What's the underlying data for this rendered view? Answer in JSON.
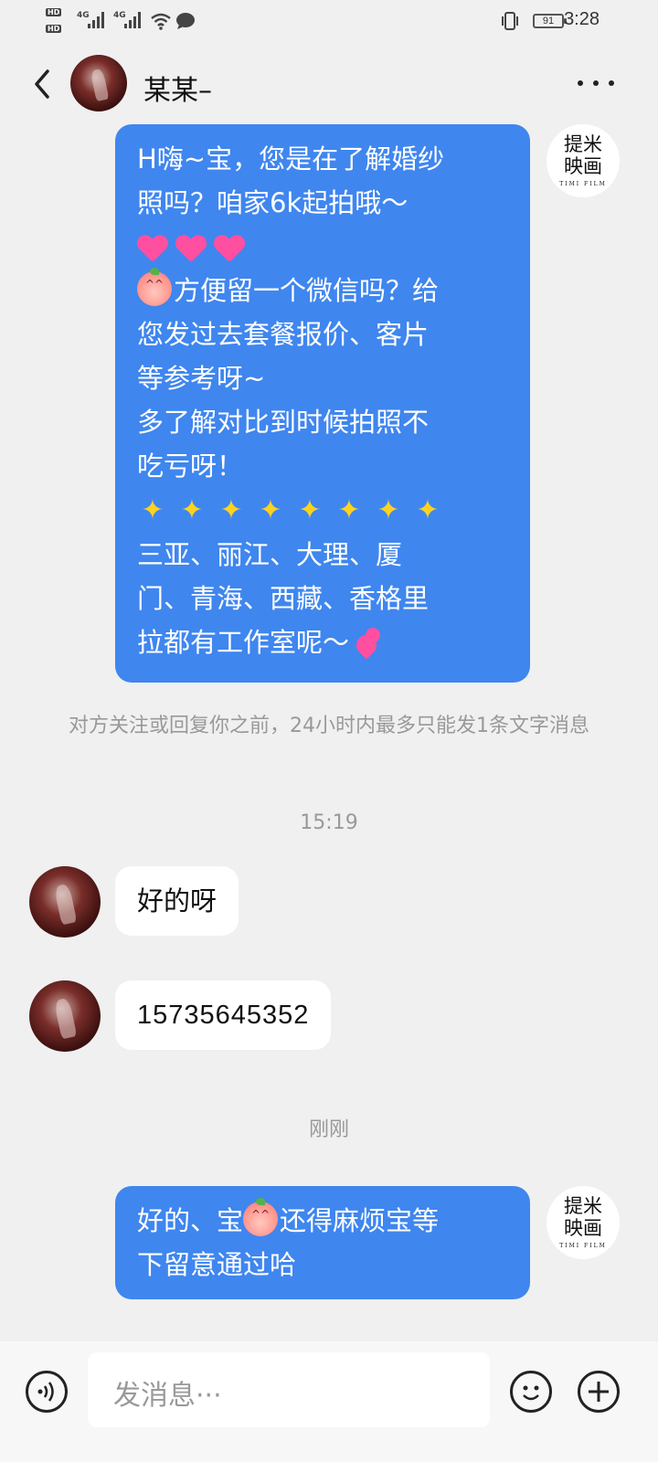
{
  "status_bar": {
    "hd1": "HD",
    "hd2": "HD",
    "net1": "4G",
    "net2": "4G",
    "battery": "91",
    "time": "3:28"
  },
  "header": {
    "contact_name": "某某–",
    "back_icon": "chevron-left-icon",
    "more_icon": "more-dots-icon"
  },
  "brand_logo": {
    "line1": "提米",
    "line2": "映画",
    "line3": "TIMI FILM"
  },
  "messages": {
    "m1": {
      "line1": "H嗨~宝，您是在了解婚纱",
      "line2": "照吗？咱家6k起拍哦～",
      "line4": "方便留一个微信吗？给",
      "line5": "您发过去套餐报价、客片",
      "line6": "等参考呀~",
      "line7": "多了解对比到时候拍照不",
      "line8": "吃亏呀！",
      "line10": "三亚、丽江、大理、厦",
      "line11": "门、青海、西藏、香格里",
      "line12": "拉都有工作室呢～"
    },
    "system_note": "对方关注或回复你之前，24小时内最多只能发1条文字消息",
    "time1": "15:19",
    "m2": "好的呀",
    "m3": "15735645352",
    "time2": "刚刚",
    "m4": {
      "line1a": "好的、宝",
      "line1b": "还得麻烦宝等",
      "line2": "下留意通过哈"
    }
  },
  "input_bar": {
    "placeholder": "发消息···",
    "voice_icon": "voice-icon",
    "emoji_icon": "smiley-icon",
    "plus_icon": "plus-icon"
  }
}
